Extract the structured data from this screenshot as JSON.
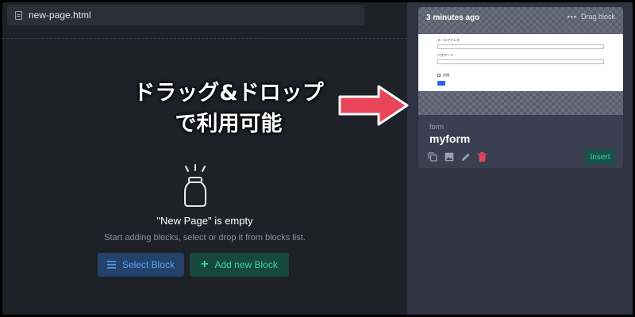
{
  "file_tab": {
    "name": "new-page.html",
    "icon": "file-icon"
  },
  "overlay": {
    "line1": "ドラッグ&ドロップ",
    "line2": "で利用可能"
  },
  "empty_state": {
    "title": "\"New Page\" is empty",
    "subtitle": "Start adding blocks, select or drop it from blocks list.",
    "icon": "jar-icon"
  },
  "buttons": {
    "select_block": "Select Block",
    "add_block": "Add new Block"
  },
  "block_card": {
    "time": "3 minutes ago",
    "drag_label": "Drag block",
    "category": "form",
    "name": "myform",
    "insert_label": "Insert",
    "preview": {
      "label1": "メールアドレス",
      "label2": "パスワード",
      "check_label": "記憶"
    },
    "actions": [
      "copy-icon",
      "image-icon",
      "edit-icon",
      "trash-icon"
    ]
  },
  "colors": {
    "background": "#1e2128",
    "panel": "#2f3341",
    "select_button": "#23426a",
    "add_button": "#17483f",
    "accent_blue": "#5aa2f0",
    "accent_green": "#3cd3a6",
    "arrow_fill": "#e8455a",
    "trash": "#e8455a"
  }
}
